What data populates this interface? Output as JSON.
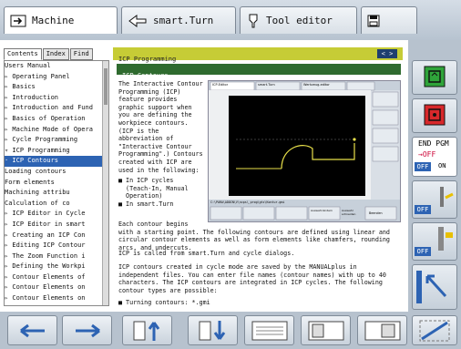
{
  "tabs": [
    {
      "label": "Machine",
      "icon": "machine-icon"
    },
    {
      "label": "smart.Turn",
      "icon": "smart-turn-icon"
    },
    {
      "label": "Tool editor",
      "icon": "tool-editor-icon"
    },
    {
      "label": "",
      "icon": "save-icon"
    }
  ],
  "left_tabs": [
    "Contents",
    "Index",
    "Find"
  ],
  "tree": [
    "  Users Manual",
    "▹ Operating Panel",
    "▹ Basics",
    "▹ Introduction",
    "▹ Introduction and Fund",
    "▹ Basics of Operation",
    "▹ Machine Mode of Opera",
    "▹ Cycle Programming",
    "▿ ICP Programming",
    "  · ICP Contours",
    "    Loading contours",
    "    Form elements",
    "    Machining attribu",
    "    Calculation of co",
    "▹ ICP Editor in Cycle",
    "▹ ICP Editor in smart",
    "▹ Creating an ICP Con",
    "▹ Editing ICP Contour",
    "▹ The Zoom Function i",
    "▹ Defining the Workpi",
    "▹ Contour Elements of",
    "▹ Contour Elements on",
    "▹ Contour Elements on"
  ],
  "tree_selected": 9,
  "header": {
    "breadcrumb": "ICP Programming",
    "nav": "< >"
  },
  "section_title": "ICP Contours",
  "para1": "The Interactive Contour\nProgramming (ICP)\nfeature provides\ngraphic support when\nyou are defining the\nworkpiece contours.\n(ICP is the\nabbreviation of\n\"Interactive Contour\nProgramming\".) Contours\ncreated with ICP are\nused in the following:",
  "bullets": "■ In ICP cycles\n  (Teach-In, Manual\n  Operation)\n■ In smart.Turn",
  "para2": "Each contour begins\nwith a starting point. The following contours are defined using linear and\ncircular contour elements as well as form elements like chamfers, rounding\narcs, and undercuts.",
  "para3": "ICP is called from smart.Turn and cycle dialogs.",
  "para4": "ICP contours created in cycle mode are saved by the MANUALplus in\nindependent files. You can enter file names (contour names) with up to 40\ncharacters. The ICP contours are integrated in ICP cycles. The following\ncontour types are possible:",
  "bullet2": "■ Turning contours: *.gmi",
  "screenshot": {
    "tabs": [
      "ICP-Editor",
      "smart.Turn",
      "Werkzeug-editor"
    ],
    "path": "C:\\PARA\\ADDIN\\V\\ncps\\_prog\\gtz\\Kontur.gmi",
    "buttons": [
      "",
      "",
      "Auswahl ändern",
      "Auswahl schneiden",
      "Beenden"
    ]
  },
  "sidebar": {
    "end_pgm": "END PGM",
    "off": "OFF",
    "on": "ON",
    "off_label": "OFF"
  },
  "colors": {
    "header": "#c6cc36",
    "title": "#2f6b2f",
    "selected": "#2d63b3"
  }
}
